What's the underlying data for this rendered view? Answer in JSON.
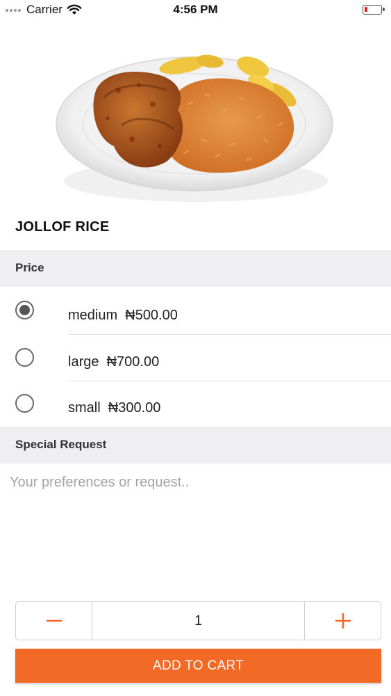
{
  "status_bar": {
    "carrier": "Carrier",
    "time": "4:56 PM",
    "battery_color": "#e0242a"
  },
  "hero_image": {
    "icon": "jollof-rice-plate-photo"
  },
  "product": {
    "title": "JOLLOF RICE"
  },
  "price_section": {
    "header": "Price",
    "options": [
      {
        "label": "medium  ₦500.00",
        "selected": true
      },
      {
        "label": "large  ₦700.00",
        "selected": false
      },
      {
        "label": "small  ₦300.00",
        "selected": false
      }
    ]
  },
  "special_request": {
    "header": "Special Request",
    "placeholder": "Your preferences or request..",
    "value": ""
  },
  "quantity": {
    "value": "1",
    "accent": "#f26a25"
  },
  "add_to_cart": {
    "label": "ADD TO CART",
    "color": "#f26a25"
  }
}
